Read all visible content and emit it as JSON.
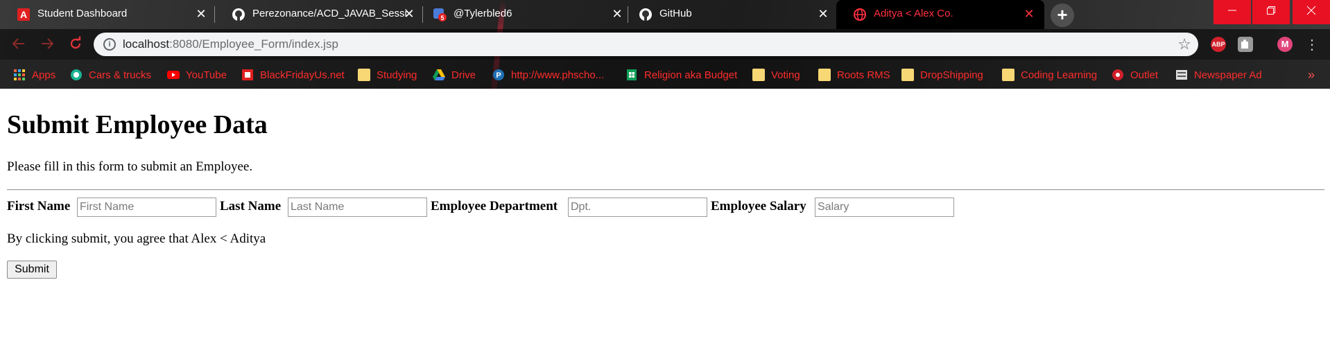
{
  "browser": {
    "tabs": [
      {
        "title": "Student Dashboard",
        "favicon": "adobe-a-icon"
      },
      {
        "title": "Perezonance/ACD_JAVAB_Session",
        "favicon": "github-icon"
      },
      {
        "title": "@Tylerbled6",
        "favicon": "notification-badge-icon",
        "badge": "5"
      },
      {
        "title": "GitHub",
        "favicon": "github-icon"
      },
      {
        "title": "Aditya < Alex Co.",
        "favicon": "globe-icon",
        "active": true
      }
    ],
    "tab_close_glyph": "✕",
    "new_tab_glyph": "+",
    "url_host": "localhost",
    "url_rest": ":8080/Employee_Form/index.jsp",
    "extensions": {
      "abp": "ABP",
      "profile_initial": "M"
    },
    "bookmarks": [
      {
        "label": "Apps",
        "icon": "apps-grid-icon"
      },
      {
        "label": "Cars & trucks",
        "icon": "site-icon"
      },
      {
        "label": "YouTube",
        "icon": "youtube-icon"
      },
      {
        "label": "BlackFridayUs.net",
        "icon": "site-icon"
      },
      {
        "label": "Studying",
        "icon": "folder-icon"
      },
      {
        "label": "Drive",
        "icon": "drive-icon"
      },
      {
        "label": "http://www.phscho...",
        "icon": "site-icon"
      },
      {
        "label": "Religion aka Budget",
        "icon": "sheets-icon"
      },
      {
        "label": "Voting",
        "icon": "folder-icon"
      },
      {
        "label": "Roots RMS",
        "icon": "folder-icon"
      },
      {
        "label": "DropShipping",
        "icon": "folder-icon"
      },
      {
        "label": "Coding Learning",
        "icon": "folder-icon"
      },
      {
        "label": "Outlet",
        "icon": "site-icon"
      },
      {
        "label": "Newspaper Ad",
        "icon": "site-icon"
      }
    ],
    "bookmarks_overflow": "»",
    "colors": {
      "accent": "#ff2c2c",
      "close_red": "#e81123"
    }
  },
  "page": {
    "heading": "Submit Employee Data",
    "intro": "Please fill in this form to submit an Employee.",
    "fields": [
      {
        "label": "First Name",
        "placeholder": "First Name",
        "value": ""
      },
      {
        "label": "Last Name",
        "placeholder": "Last Name",
        "value": ""
      },
      {
        "label": "Employee Department",
        "placeholder": "Dpt.",
        "value": ""
      },
      {
        "label": "Employee Salary",
        "placeholder": "Salary",
        "value": ""
      }
    ],
    "agreement": "By clicking submit, you agree that Alex < Aditya",
    "submit_label": "Submit"
  }
}
